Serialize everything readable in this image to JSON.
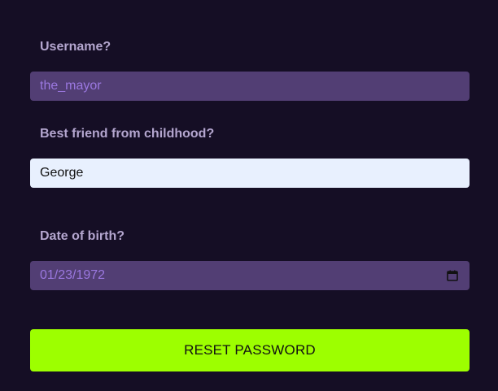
{
  "form": {
    "username": {
      "label": "Username?",
      "value": "the_mayor"
    },
    "friend": {
      "label": "Best friend from childhood?",
      "value": "George"
    },
    "dob": {
      "label": "Date of birth?",
      "value": "01/23/1972",
      "icon": "calendar-icon"
    },
    "submit_label": "RESET PASSWORD"
  },
  "colors": {
    "background": "#150e25",
    "label": "#b4a6cf",
    "field_disabled_bg": "#523e74",
    "field_disabled_text": "#9b78e0",
    "field_active_bg": "#e8f0fe",
    "button_bg": "#9dff00"
  }
}
